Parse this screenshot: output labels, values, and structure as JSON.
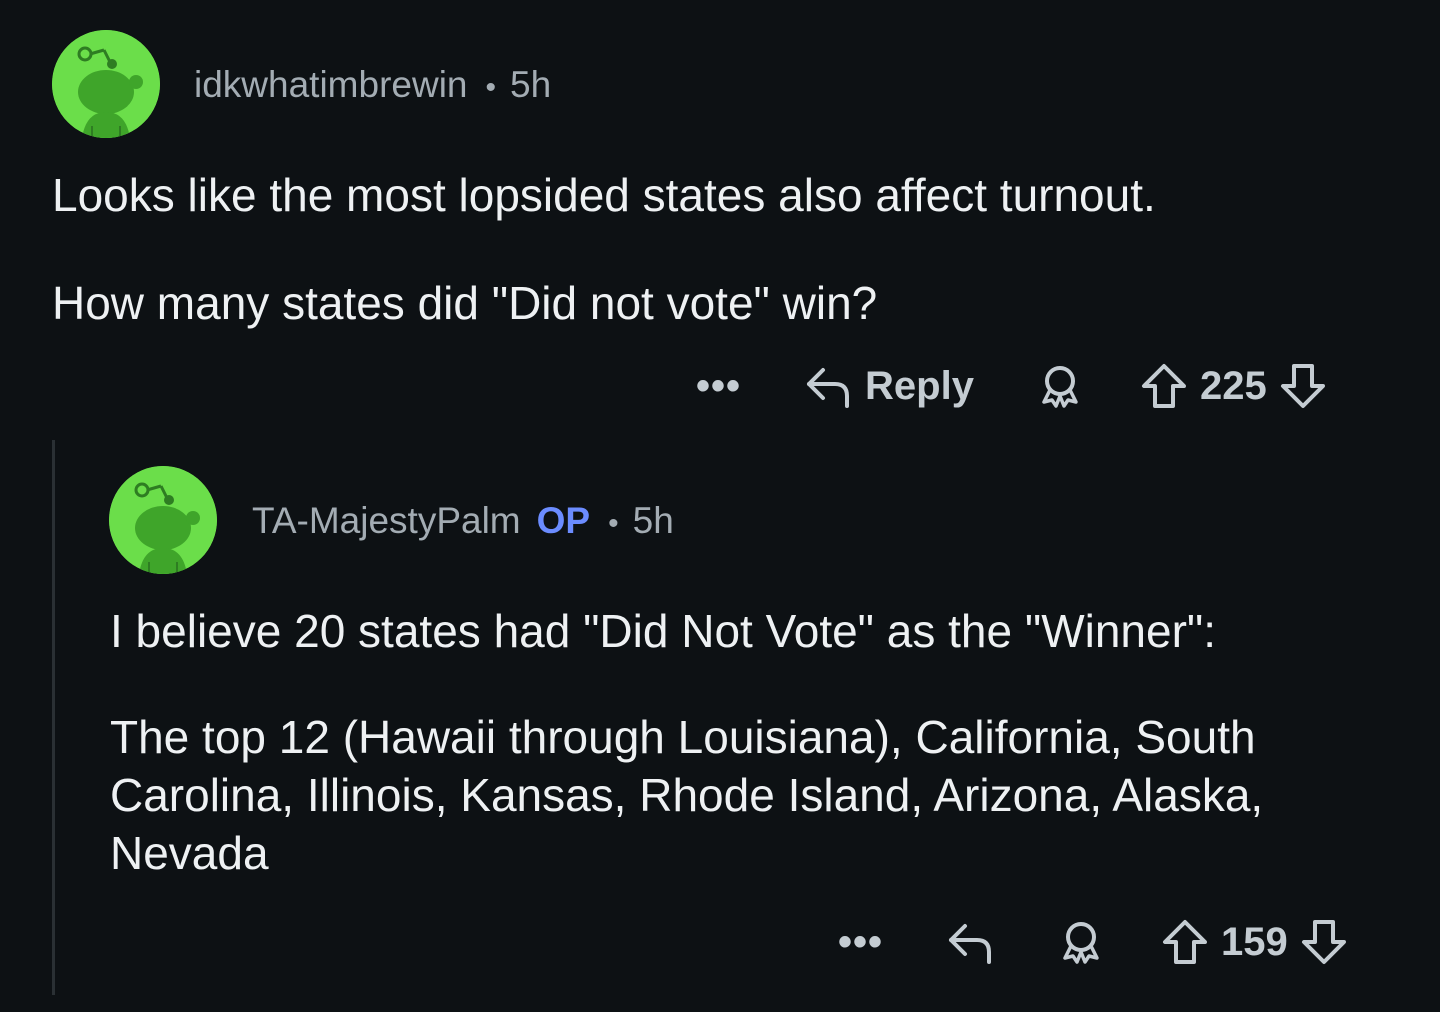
{
  "comments": [
    {
      "username": "idkwhatimbrewin",
      "separator": "•",
      "time": "5h",
      "paragraphs": [
        "Looks like the most lopsided states also affect turnout.",
        "How many states did \"Did not vote\" win?"
      ],
      "actions": {
        "more_label": "•••",
        "reply_label": "Reply",
        "score": "225",
        "reply_icon": "reply-arrow-icon",
        "award_icon": "award-icon",
        "upvote_icon": "upvote-arrow-icon",
        "downvote_icon": "downvote-arrow-icon"
      }
    },
    {
      "username": "TA-MajestyPalm",
      "badge": "OP",
      "separator": "•",
      "time": "5h",
      "paragraphs": [
        "I believe 20 states had \"Did Not Vote\" as the \"Winner\":",
        "The top 12 (Hawaii through Louisiana), California, South Carolina, Illinois, Kansas, Rhode Island, Arizona, Alaska, Nevada"
      ],
      "actions": {
        "more_label": "•••",
        "score": "159",
        "reply_icon": "reply-arrow-icon",
        "award_icon": "award-icon",
        "upvote_icon": "upvote-arrow-icon",
        "downvote_icon": "downvote-arrow-icon"
      }
    }
  ],
  "colors": {
    "background": "#0d1114",
    "avatar": "#6bde4a",
    "op_badge": "#6b8cff",
    "meta_text": "#a3acb3",
    "body_text": "#eef1f3"
  }
}
